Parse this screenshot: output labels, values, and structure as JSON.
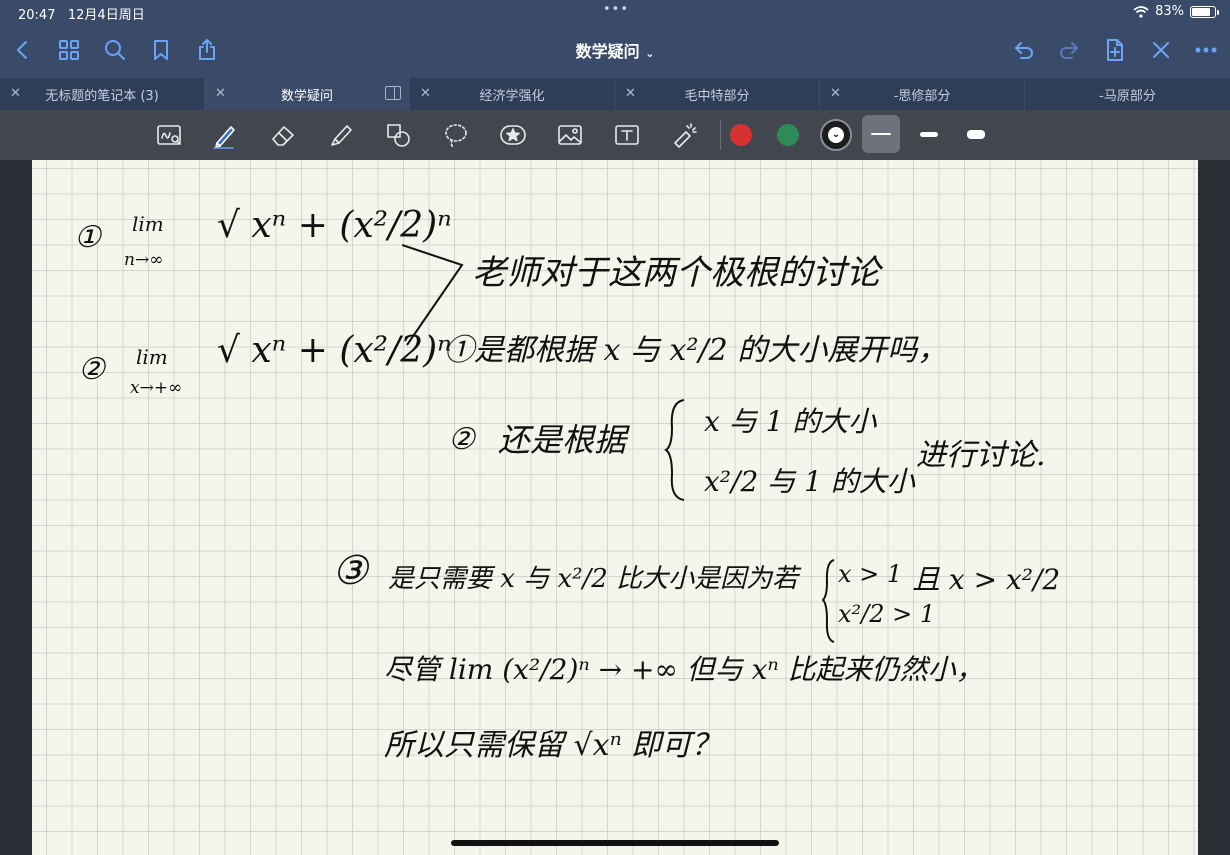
{
  "status": {
    "time": "20:47",
    "date": "12月4日周日",
    "battery": "83%",
    "battery_level": 0.83,
    "dots": "•••"
  },
  "nav": {
    "title": "数学疑问",
    "icons": [
      "back-icon",
      "grid-icon",
      "search-icon",
      "bookmark-icon",
      "share-icon",
      "undo-icon",
      "redo-icon",
      "add-page-icon",
      "close-pen-icon",
      "more-icon"
    ]
  },
  "tabs": [
    {
      "label": "无标题的笔记本 (3)",
      "active": false
    },
    {
      "label": "数学疑问",
      "active": true
    },
    {
      "label": "经济学强化",
      "active": false
    },
    {
      "label": "毛中特部分",
      "active": false
    },
    {
      "label": "-思修部分",
      "active": false
    },
    {
      "label": "-马原部分",
      "active": false
    }
  ],
  "toolbar": {
    "tools": [
      "zoom-window-icon",
      "pen-icon",
      "eraser-icon",
      "highlighter-icon",
      "shapes-icon",
      "lasso-icon",
      "sticker-icon",
      "image-icon",
      "text-icon",
      "laser-pointer-icon"
    ],
    "colors": [
      "#d63232",
      "#2e8b57",
      "#1c1c1c"
    ]
  },
  "note": {
    "line1_lim": "lim",
    "line1_sub": "n→∞",
    "line1_expr": "√ xⁿ + (x²/2)ⁿ",
    "line1_num": "①",
    "line2_num": "②",
    "line2_lim": "lim",
    "line2_sub": "x→+∞",
    "line2_expr": "√ xⁿ + (x²/2)ⁿ",
    "q_intro": "老师对于这两个极根的讨论",
    "q1": "①是都根据 x 与 x²/2 的大小展开吗，",
    "q2_num": "②",
    "q2_a": "还是根据",
    "q2_b1": "x 与 1 的大小",
    "q2_b2": "x²/2 与 1 的大小",
    "q2_c": "进行讨论.",
    "q3_num": "③",
    "q3_a": "是只需要 x 与 x²/2 比大小是因为若",
    "q3_cond1": "x > 1",
    "q3_cond2": "x²/2 > 1",
    "q3_b": "且 x > x²/2",
    "q3_line2": "尽管 lim (x²/2)ⁿ → +∞ 但与 xⁿ 比起来仍然小，",
    "q3_line3": "所以只需保留 √xⁿ 即可？"
  }
}
